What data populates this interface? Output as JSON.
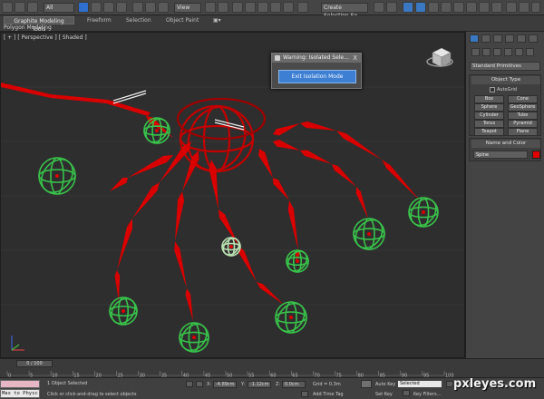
{
  "toolbar": {
    "selection_filter": "All",
    "reference_coord": "View",
    "named_selection": "Create Selection Se"
  },
  "ribbon": {
    "tabs": [
      {
        "label": "Graphite Modeling Tools",
        "active": true
      },
      {
        "label": "Freeform",
        "active": false
      },
      {
        "label": "Selection",
        "active": false
      },
      {
        "label": "Object Paint",
        "active": false
      }
    ],
    "subtitle": "Polygon Modeling"
  },
  "viewport": {
    "label": "[ + ] [ Perspective ] [ Shaded ]"
  },
  "dialog": {
    "title": "Warning: Isolated Sele...",
    "close_glyph": "X",
    "button_label": "Exit Isolation Mode"
  },
  "command_panel": {
    "primitives_dropdown": "Standard Primitives",
    "object_type_header": "Object Type",
    "autogrid_label": "AutoGrid",
    "buttons": [
      "Box",
      "Cone",
      "Sphere",
      "GeoSphere",
      "Cylinder",
      "Tube",
      "Torus",
      "Pyramid",
      "Teapot",
      "Plane"
    ],
    "name_color_header": "Name and Color",
    "name_value": "Spine",
    "object_color": "#e00000"
  },
  "timeline": {
    "frame_display": "0 / 100",
    "ticks": [
      "0",
      "5",
      "10",
      "15",
      "20",
      "25",
      "30",
      "35",
      "40",
      "45",
      "50",
      "55",
      "60",
      "65",
      "70",
      "75",
      "80",
      "85",
      "90",
      "95",
      "100"
    ]
  },
  "status": {
    "maxscript_text": "Max to Physc",
    "objects_selected": "1 Object Selected",
    "prompt": "Click or click-and-drag to select objects",
    "x_label": "X:",
    "x_value": "-4.89cm",
    "y_label": "Y:",
    "y_value": "-1.12cm",
    "z_label": "Z:",
    "z_value": "0.0cm",
    "grid": "Grid = 0.3m",
    "add_time_tag": "Add Time Tag",
    "auto_key": "Auto Key",
    "set_key": "Set Key",
    "selected_dd": "Selected",
    "key_filters": "Key Filters..."
  },
  "watermark": "pxleyes.com",
  "colors": {
    "bone_red": "#d90000",
    "helper_green": "#38c24a",
    "ui_blue": "#3d7fd3"
  }
}
